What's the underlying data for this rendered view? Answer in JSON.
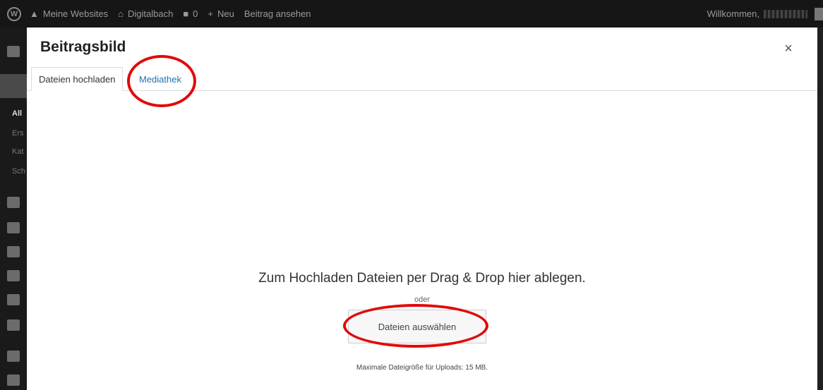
{
  "admin_bar": {
    "wp_logo": "wordpress-logo",
    "my_sites": "Meine Websites",
    "site_name": "Digitalbach",
    "comments_count": "0",
    "new_label": "Neu",
    "view_post": "Beitrag ansehen",
    "welcome": "Willkommen,"
  },
  "admin_menu": {
    "submenu": [
      "All",
      "Ers",
      "Kat",
      "Sch"
    ]
  },
  "modal": {
    "title": "Beitragsbild",
    "close_symbol": "×",
    "tabs": [
      {
        "label": "Dateien hochladen",
        "active": true
      },
      {
        "label": "Mediathek",
        "active": false
      }
    ],
    "drop_message": "Zum Hochladen Dateien per Drag & Drop hier ablegen.",
    "or_text": "oder",
    "select_button": "Dateien auswählen",
    "max_size": "Maximale Dateigröße für Uploads: 15 MB."
  },
  "colors": {
    "link": "#2271b1",
    "highlight": "#e10a0a",
    "adminbar_bg": "#161616"
  }
}
